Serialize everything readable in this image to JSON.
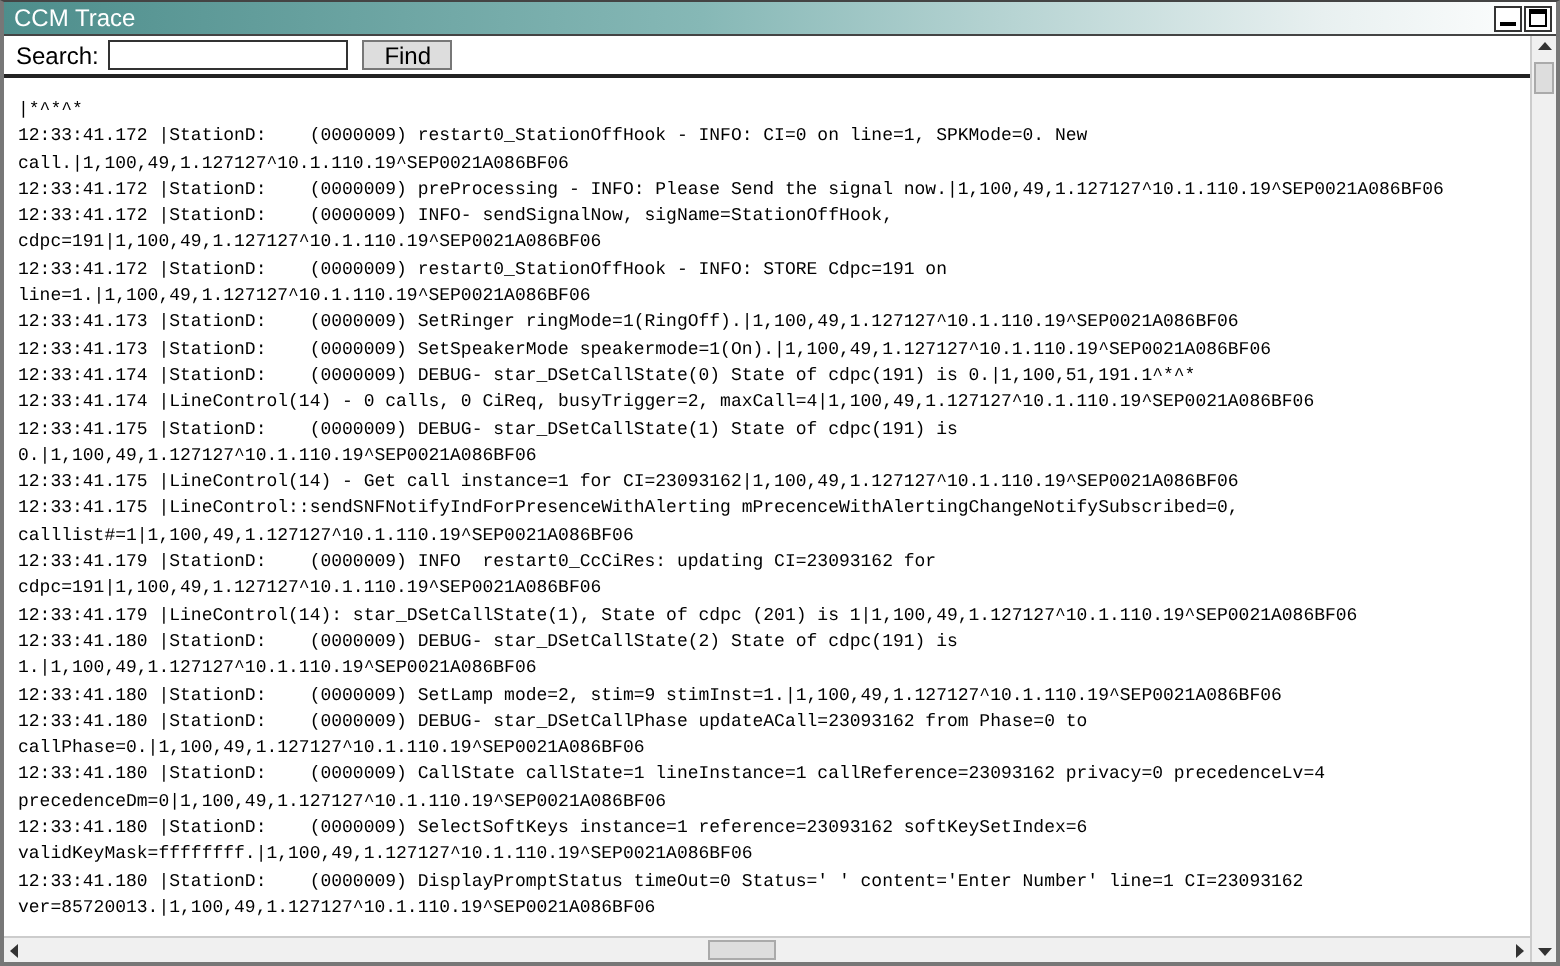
{
  "window": {
    "title": "CCM Trace"
  },
  "search": {
    "label": "Search:",
    "button": "Find"
  },
  "log_lines": [
    "|*^*^*",
    "12:33:41.172 |StationD:    (0000009) restart0_StationOffHook - INFO: CI=0 on line=1, SPKMode=0. New",
    "call.|1,100,49,1.127127^10.1.110.19^SEP0021A086BF06",
    "12:33:41.172 |StationD:    (0000009) preProcessing - INFO: Please Send the signal now.|1,100,49,1.127127^10.1.110.19^SEP0021A086BF06",
    "12:33:41.172 |StationD:    (0000009) INFO- sendSignalNow, sigName=StationOffHook,",
    "cdpc=191|1,100,49,1.127127^10.1.110.19^SEP0021A086BF06",
    "12:33:41.172 |StationD:    (0000009) restart0_StationOffHook - INFO: STORE Cdpc=191 on",
    "line=1.|1,100,49,1.127127^10.1.110.19^SEP0021A086BF06",
    "12:33:41.173 |StationD:    (0000009) SetRinger ringMode=1(RingOff).|1,100,49,1.127127^10.1.110.19^SEP0021A086BF06",
    "12:33:41.173 |StationD:    (0000009) SetSpeakerMode speakermode=1(On).|1,100,49,1.127127^10.1.110.19^SEP0021A086BF06",
    "12:33:41.174 |StationD:    (0000009) DEBUG- star_DSetCallState(0) State of cdpc(191) is 0.|1,100,51,191.1^*^*",
    "12:33:41.174 |LineControl(14) - 0 calls, 0 CiReq, busyTrigger=2, maxCall=4|1,100,49,1.127127^10.1.110.19^SEP0021A086BF06",
    "12:33:41.175 |StationD:    (0000009) DEBUG- star_DSetCallState(1) State of cdpc(191) is",
    "0.|1,100,49,1.127127^10.1.110.19^SEP0021A086BF06",
    "12:33:41.175 |LineControl(14) - Get call instance=1 for CI=23093162|1,100,49,1.127127^10.1.110.19^SEP0021A086BF06",
    "12:33:41.175 |LineControl::sendSNFNotifyIndForPresenceWithAlerting mPrecenceWithAlertingChangeNotifySubscribed=0,",
    "calllist#=1|1,100,49,1.127127^10.1.110.19^SEP0021A086BF06",
    "12:33:41.179 |StationD:    (0000009) INFO  restart0_CcCiRes: updating CI=23093162 for",
    "cdpc=191|1,100,49,1.127127^10.1.110.19^SEP0021A086BF06",
    "12:33:41.179 |LineControl(14): star_DSetCallState(1), State of cdpc (201) is 1|1,100,49,1.127127^10.1.110.19^SEP0021A086BF06",
    "12:33:41.180 |StationD:    (0000009) DEBUG- star_DSetCallState(2) State of cdpc(191) is",
    "1.|1,100,49,1.127127^10.1.110.19^SEP0021A086BF06",
    "12:33:41.180 |StationD:    (0000009) SetLamp mode=2, stim=9 stimInst=1.|1,100,49,1.127127^10.1.110.19^SEP0021A086BF06",
    "12:33:41.180 |StationD:    (0000009) DEBUG- star_DSetCallPhase updateACall=23093162 from Phase=0 to",
    "callPhase=0.|1,100,49,1.127127^10.1.110.19^SEP0021A086BF06",
    "12:33:41.180 |StationD:    (0000009) CallState callState=1 lineInstance=1 callReference=23093162 privacy=0 precedenceLv=4",
    "precedenceDm=0|1,100,49,1.127127^10.1.110.19^SEP0021A086BF06",
    "12:33:41.180 |StationD:    (0000009) SelectSoftKeys instance=1 reference=23093162 softKeySetIndex=6",
    "validKeyMask=ffffffff.|1,100,49,1.127127^10.1.110.19^SEP0021A086BF06",
    "12:33:41.180 |StationD:    (0000009) DisplayPromptStatus timeOut=0 Status=' ' content='Enter Number' line=1 CI=23093162",
    "ver=85720013.|1,100,49,1.127127^10.1.110.19^SEP0021A086BF06"
  ]
}
